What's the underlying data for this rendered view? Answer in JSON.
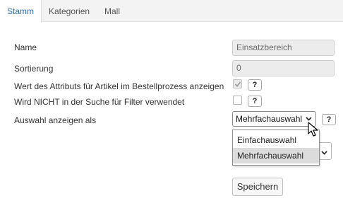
{
  "tabs": [
    {
      "label": "Stamm",
      "active": true
    },
    {
      "label": "Kategorien",
      "active": false
    },
    {
      "label": "Mall",
      "active": false
    }
  ],
  "form": {
    "name": {
      "label": "Name",
      "value": "Einsatzbereich"
    },
    "sort": {
      "label": "Sortierung",
      "value": "0"
    },
    "show_in_order": {
      "label": "Wert des Attributs für Artikel im Bestellprozess anzeigen",
      "checked": true,
      "help": "?"
    },
    "not_in_search": {
      "label": "Wird NICHT in der Suche für Filter verwendet",
      "checked": false,
      "help": "?"
    },
    "display_as": {
      "label": "Auswahl anzeigen als",
      "selected": "Mehrfachauswahl",
      "help": "?",
      "options": [
        "Einfachauswahl",
        "Mehrfachauswahl"
      ],
      "highlighted_option": "Mehrfachauswahl"
    }
  },
  "save_label": "Speichern",
  "colors": {
    "active_tab_text": "#2a6fb0",
    "tab_bar": "#f3f3f3",
    "readonly_input": "#ececec",
    "option_highlight": "#dcdcdc"
  },
  "icons": {
    "select_arrow": "chevron-down-icon",
    "check": "check-icon",
    "pointer": "mouse-cursor-icon"
  }
}
